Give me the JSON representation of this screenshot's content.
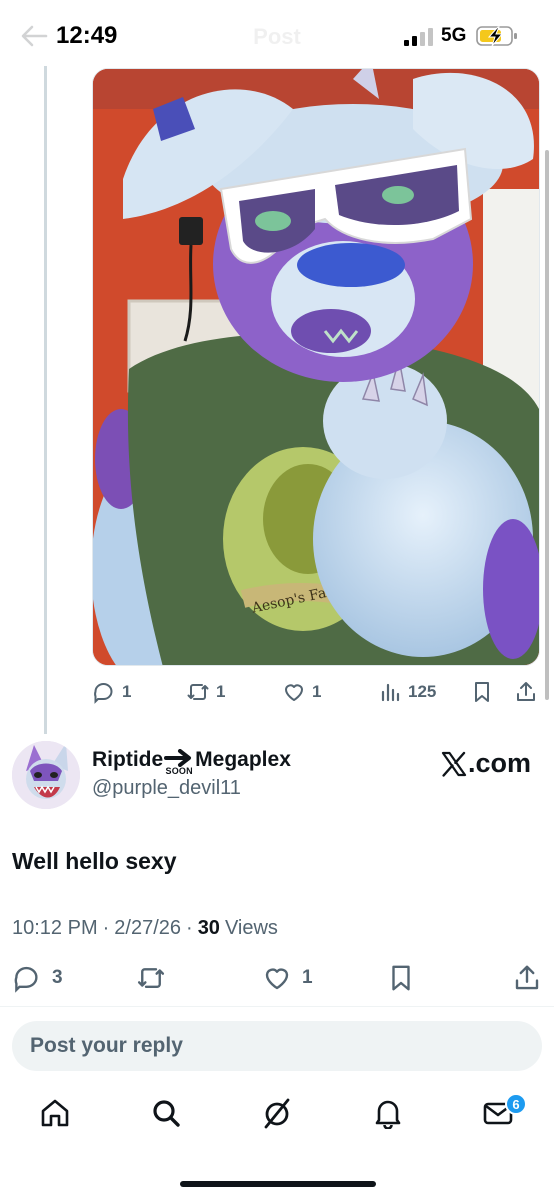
{
  "status_bar": {
    "time": "12:49",
    "network": "5G"
  },
  "header": {
    "title": "Post"
  },
  "quoted_post": {
    "media_alt": "Photo of a purple and light-blue fursuit wearing white sunglasses and a green shirt reading Aesop's Fables",
    "shirt_text": "Aesop's Fables",
    "reply_count": "1",
    "repost_count": "1",
    "like_count": "1",
    "view_count": "125"
  },
  "post": {
    "display_name_part1": "Riptide",
    "display_name_mark": "SOON",
    "display_name_part2": "Megaplex",
    "handle": "@purple_devil11",
    "watermark": ".com",
    "text": "Well hello sexy",
    "time": "10:12 PM",
    "date": "2/27/26",
    "sep": "·",
    "views_count": "30",
    "views_label": "Views",
    "reply_count": "3",
    "like_count": "1"
  },
  "reply_box": {
    "placeholder": "Post your reply"
  },
  "nav": {
    "messages_badge": "6"
  },
  "colors": {
    "accent": "#1d9bf0",
    "muted": "#536471",
    "text": "#0f1419"
  },
  "icons": [
    "back-arrow-icon",
    "signal-icon",
    "battery-charging-icon",
    "reply-icon",
    "repost-icon",
    "like-icon",
    "views-icon",
    "bookmark-icon",
    "share-icon",
    "x-logo-icon",
    "home-icon",
    "search-icon",
    "grok-icon",
    "notifications-icon",
    "messages-icon"
  ]
}
